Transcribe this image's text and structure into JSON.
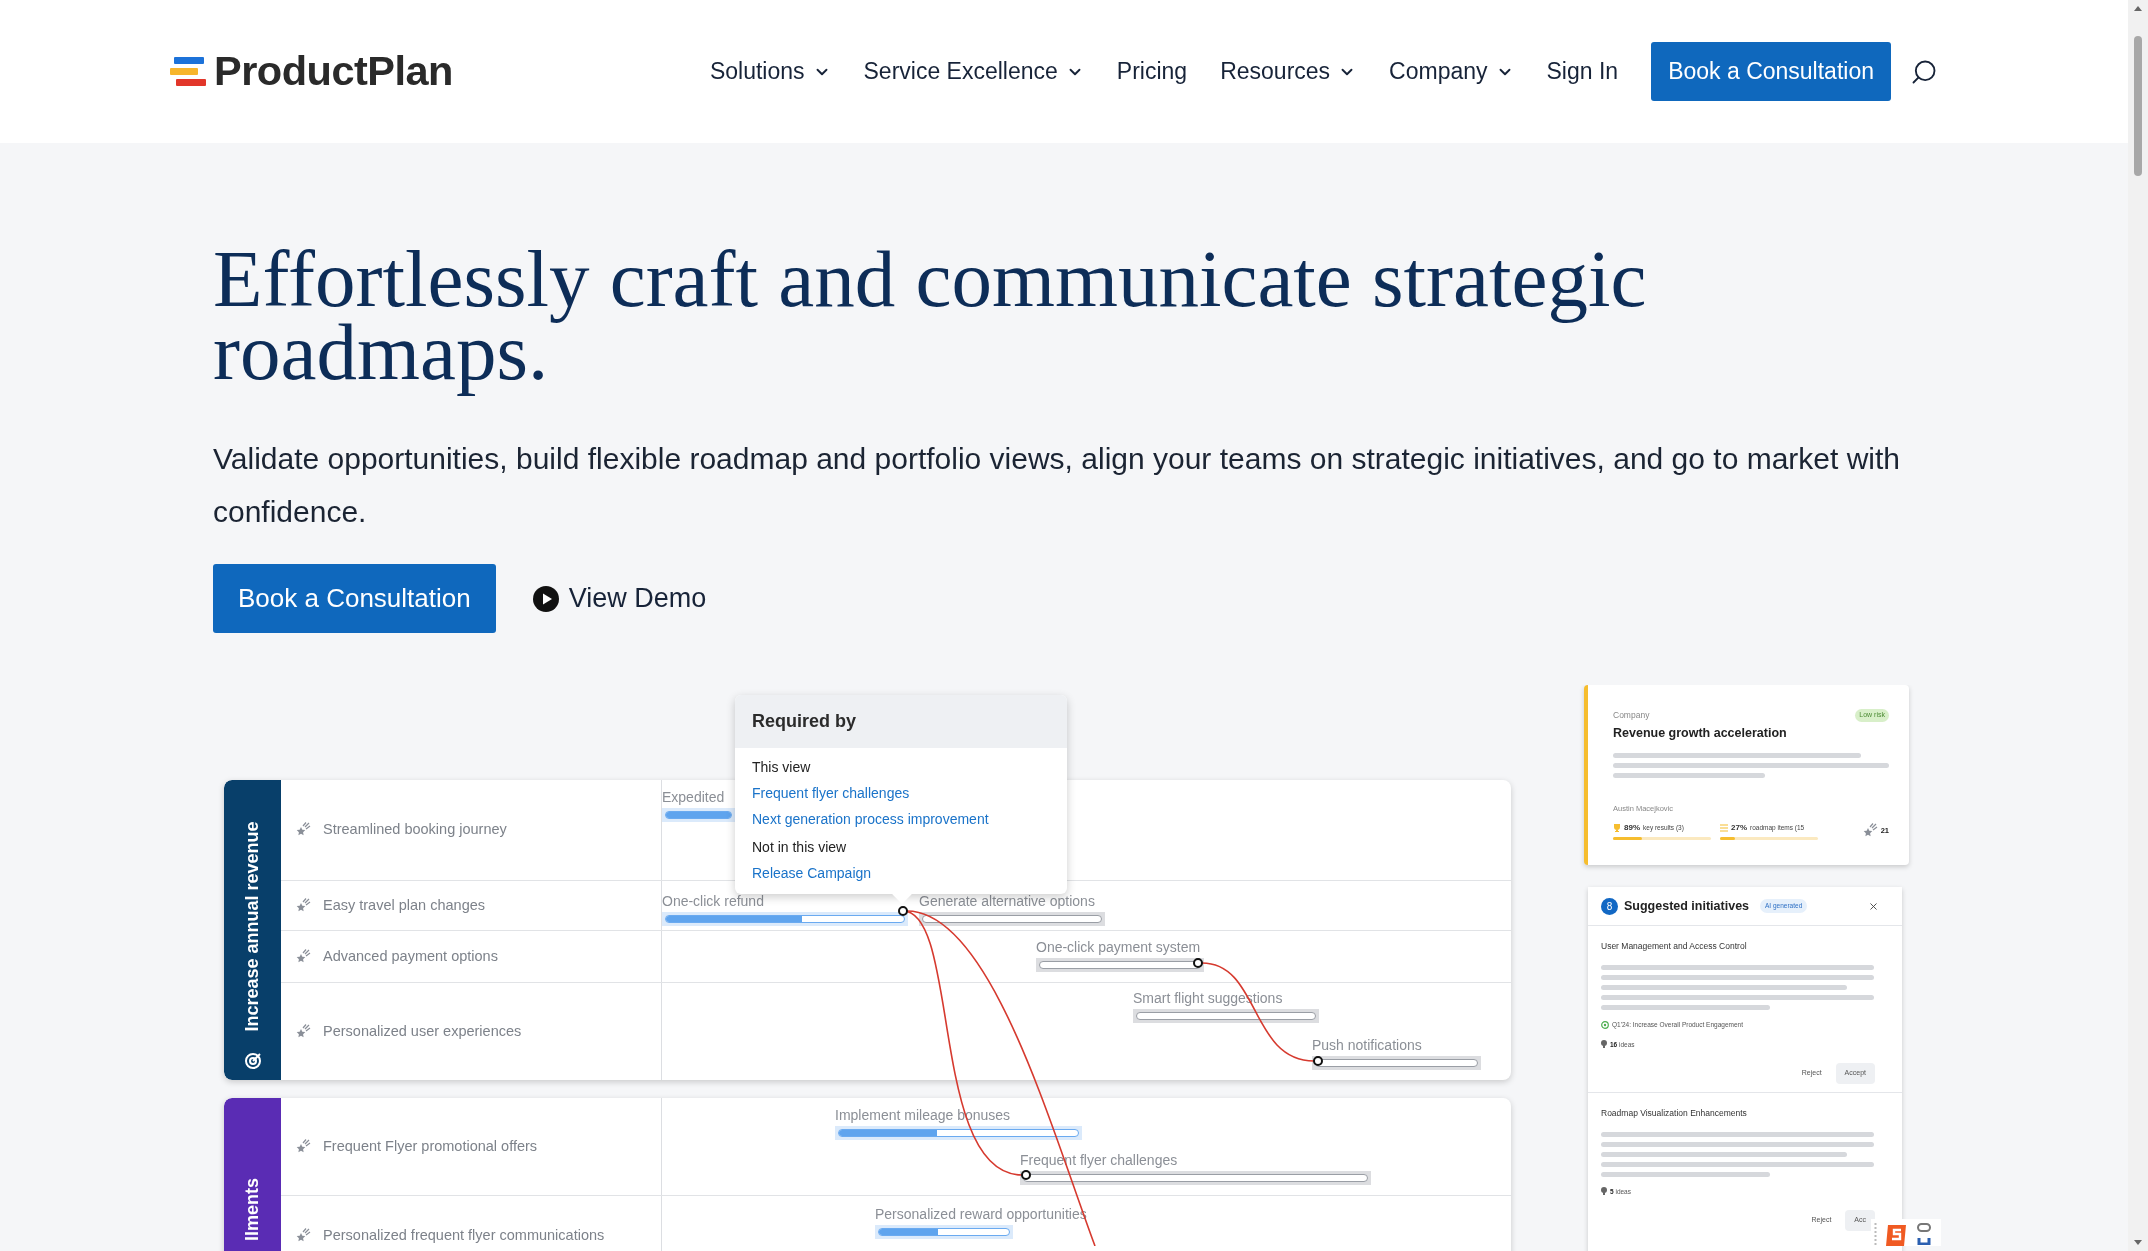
{
  "header": {
    "logo": "ProductPlan",
    "nav": [
      {
        "label": "Solutions",
        "has_menu": true
      },
      {
        "label": "Service Excellence",
        "has_menu": true
      },
      {
        "label": "Pricing",
        "has_menu": false
      },
      {
        "label": "Resources",
        "has_menu": true
      },
      {
        "label": "Company",
        "has_menu": true
      },
      {
        "label": "Sign In",
        "has_menu": false
      }
    ],
    "cta": "Book a Consultation"
  },
  "hero": {
    "title": "Effortlessly craft and communicate strategic roadmaps.",
    "subtitle": "Validate opportunities, build flexible roadmap and portfolio views, align your teams on strategic initiatives, and go to market with confidence.",
    "primary_button": "Book a Consultation",
    "demo_link": "View Demo"
  },
  "roadmap": {
    "lanes": [
      {
        "title": "Increase annual revenue",
        "color": "#083f6a",
        "rows": [
          "Streamlined booking journey",
          "Easy travel plan changes",
          "Advanced payment options",
          "Personalized user experiences"
        ]
      },
      {
        "title": "llments",
        "color": "#5a2cb4",
        "rows": [
          "Frequent Flyer promotional offers",
          "Personalized frequent flyer communications"
        ]
      }
    ],
    "bars": [
      {
        "label": "Expedited",
        "kind": "active",
        "level": 1
      },
      {
        "label": "One-click refund",
        "kind": "active",
        "level": 0.57
      },
      {
        "label": "Generate alternative options",
        "kind": "planned"
      },
      {
        "label": "One-click payment system",
        "kind": "planned"
      },
      {
        "label": "Smart flight suggestions",
        "kind": "planned"
      },
      {
        "label": "Push notifications",
        "kind": "planned"
      },
      {
        "label": "Implement mileage bonuses",
        "kind": "active",
        "level": 0.41
      },
      {
        "label": "Frequent flyer challenges",
        "kind": "planned"
      },
      {
        "label": "Personalized reward opportunities",
        "kind": "active",
        "level": 0.45
      }
    ],
    "popover": {
      "title": "Required by",
      "sections": [
        {
          "heading": "This view",
          "links": [
            "Frequent flyer challenges",
            "Next generation process improvement"
          ]
        },
        {
          "heading": "Not in this view",
          "links": [
            "Release Campaign"
          ]
        }
      ]
    }
  },
  "goal_card": {
    "category": "Company",
    "title": "Revenue growth acceleration",
    "badge": "Low risk",
    "owner": "Austin Macejkovic",
    "stats": [
      {
        "kind": "key_results",
        "value": "89%",
        "label": "key results (3)",
        "level": 0.3
      },
      {
        "kind": "roadmap_items",
        "value": "27%",
        "label": "roadmap items (15",
        "level": 0.15
      }
    ],
    "count": "21"
  },
  "suggestions": {
    "count": "8",
    "title": "Suggested initiatives",
    "tag": "AI generated",
    "items": [
      {
        "title": "User Management and Access Control",
        "goal": "Q1'24: Increase Overall Product Engagement",
        "ideas_count": "16",
        "ideas_label": "ideas",
        "reject": "Reject",
        "accept": "Accept"
      },
      {
        "title": "Roadmap Visualization Enhancements",
        "ideas_count": "5",
        "ideas_label": "ideas",
        "reject": "Reject",
        "accept": "Acc"
      }
    ]
  }
}
